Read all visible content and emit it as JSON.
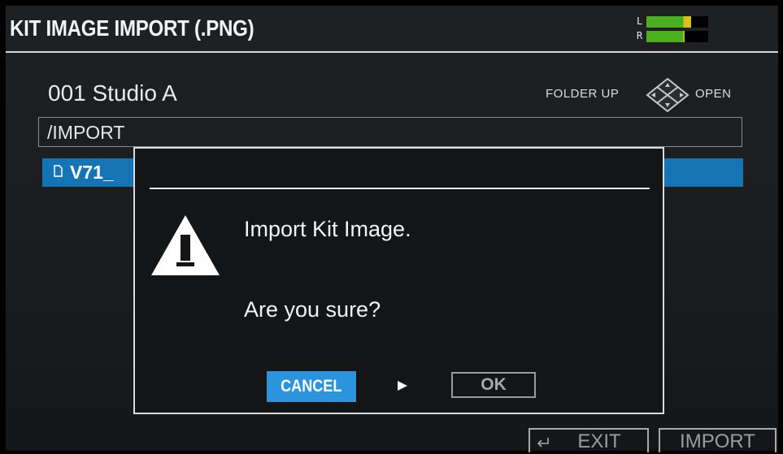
{
  "header": {
    "title": "KIT IMAGE IMPORT (.PNG)"
  },
  "meter": {
    "left_label": "L",
    "right_label": "R",
    "left_level": 0.72,
    "right_level": 0.62,
    "color_ok": "#4caf1f",
    "color_hot": "#d8c21a"
  },
  "kit": {
    "name": "001  Studio A"
  },
  "nav": {
    "folder_up": "FOLDER UP",
    "open": "OPEN"
  },
  "path": {
    "value": "/IMPORT"
  },
  "file": {
    "name": "V71_",
    "icon": "file-icon",
    "highlight": "#1674b5"
  },
  "dialog": {
    "message": "Import Kit Image.",
    "question": "Are you sure?",
    "cancel_label": "CANCEL",
    "ok_label": "OK",
    "accent": "#2c93dd",
    "warning_icon": "warning-icon"
  },
  "footer": {
    "exit_label": "EXIT",
    "import_label": "IMPORT"
  }
}
